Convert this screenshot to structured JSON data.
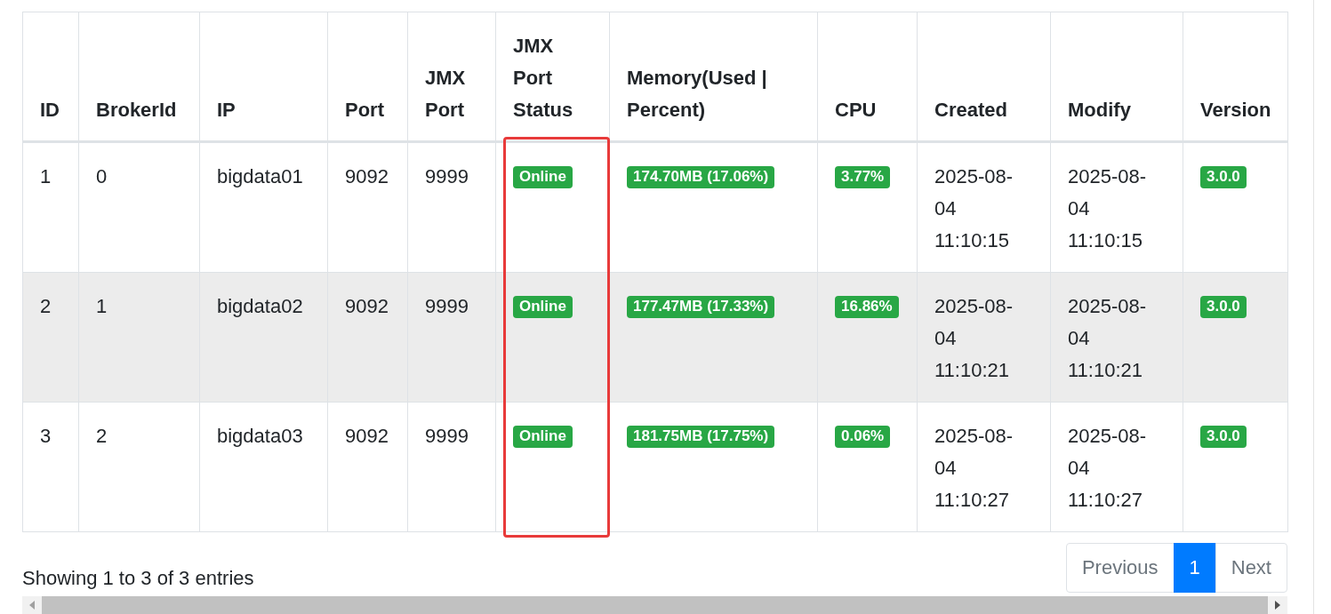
{
  "table": {
    "columns": [
      {
        "label": "ID",
        "highlighted": false
      },
      {
        "label": "BrokerId",
        "highlighted": false
      },
      {
        "label": "IP",
        "highlighted": false
      },
      {
        "label": "Port",
        "highlighted": false
      },
      {
        "label": "JMX Port",
        "highlighted": false
      },
      {
        "label": "JMX Port Status",
        "highlighted": true
      },
      {
        "label": "Memory(Used | Percent)",
        "highlighted": false
      },
      {
        "label": "CPU",
        "highlighted": false
      },
      {
        "label": "Created",
        "highlighted": false
      },
      {
        "label": "Modify",
        "highlighted": false
      },
      {
        "label": "Version",
        "highlighted": false
      }
    ],
    "rows": [
      {
        "cells": [
          {
            "kind": "text",
            "text": "1"
          },
          {
            "kind": "text",
            "text": "0"
          },
          {
            "kind": "text",
            "text": "bigdata01"
          },
          {
            "kind": "text",
            "text": "9092"
          },
          {
            "kind": "text",
            "text": "9999"
          },
          {
            "kind": "badge",
            "text": "Online"
          },
          {
            "kind": "badge",
            "text": "174.70MB (17.06%)"
          },
          {
            "kind": "badge",
            "text": "3.77%"
          },
          {
            "kind": "date",
            "text": "2025-08-04 11:10:15"
          },
          {
            "kind": "date",
            "text": "2025-08-04 11:10:15"
          },
          {
            "kind": "badge",
            "text": "3.0.0"
          }
        ]
      },
      {
        "cells": [
          {
            "kind": "text",
            "text": "2"
          },
          {
            "kind": "text",
            "text": "1"
          },
          {
            "kind": "text",
            "text": "bigdata02"
          },
          {
            "kind": "text",
            "text": "9092"
          },
          {
            "kind": "text",
            "text": "9999"
          },
          {
            "kind": "badge",
            "text": "Online"
          },
          {
            "kind": "badge",
            "text": "177.47MB (17.33%)"
          },
          {
            "kind": "badge",
            "text": "16.86%"
          },
          {
            "kind": "date",
            "text": "2025-08-04 11:10:21"
          },
          {
            "kind": "date",
            "text": "2025-08-04 11:10:21"
          },
          {
            "kind": "badge",
            "text": "3.0.0"
          }
        ]
      },
      {
        "cells": [
          {
            "kind": "text",
            "text": "3"
          },
          {
            "kind": "text",
            "text": "2"
          },
          {
            "kind": "text",
            "text": "bigdata03"
          },
          {
            "kind": "text",
            "text": "9092"
          },
          {
            "kind": "text",
            "text": "9999"
          },
          {
            "kind": "badge",
            "text": "Online"
          },
          {
            "kind": "badge",
            "text": "181.75MB (17.75%)"
          },
          {
            "kind": "badge",
            "text": "0.06%"
          },
          {
            "kind": "date",
            "text": "2025-08-04 11:10:27"
          },
          {
            "kind": "date",
            "text": "2025-08-04 11:10:27"
          },
          {
            "kind": "badge",
            "text": "3.0.0"
          }
        ]
      }
    ]
  },
  "info": "Showing 1 to 3 of 3 entries",
  "pagination": [
    {
      "label": "Previous",
      "selected": false
    },
    {
      "label": "1",
      "selected": true
    },
    {
      "label": "Next",
      "selected": false
    }
  ]
}
